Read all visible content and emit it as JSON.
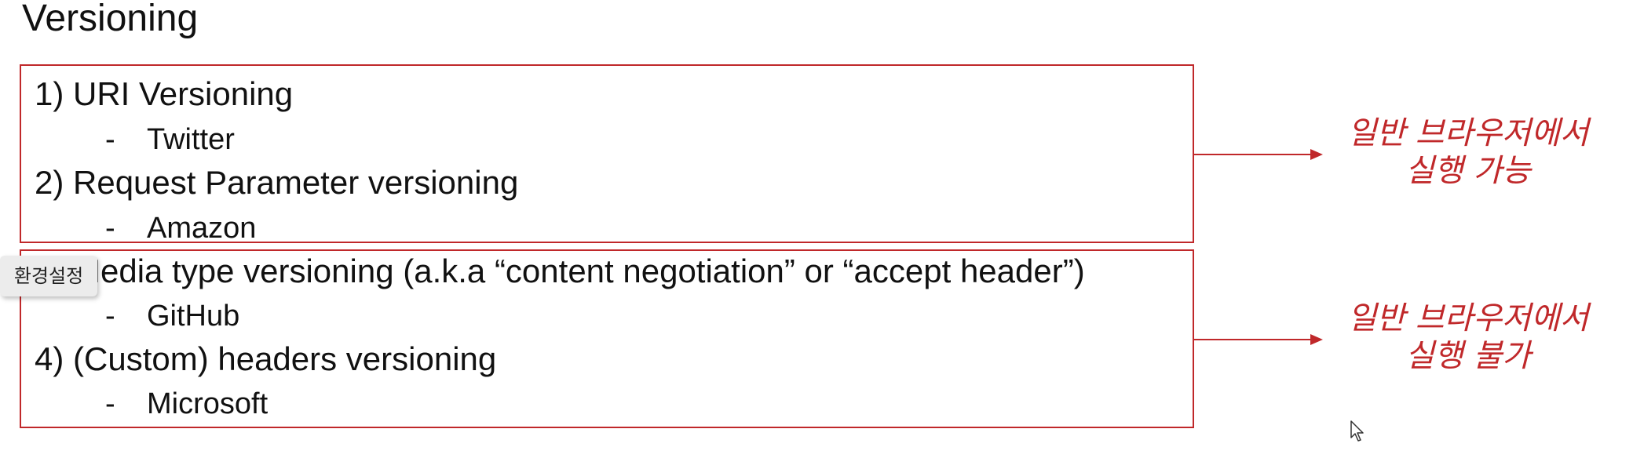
{
  "slide": {
    "title": "Versioning",
    "group1": {
      "items": [
        {
          "label": "1) URI Versioning",
          "example": "Twitter"
        },
        {
          "label": "2) Request Parameter versioning",
          "example": "Amazon"
        }
      ],
      "note_line1": "일반 브라우저에서",
      "note_line2": "실행 가능"
    },
    "group2": {
      "items": [
        {
          "label": "3) Media type versioning (a.k.a “content negotiation” or “accept header”)",
          "example": "GitHub"
        },
        {
          "label": "4) (Custom) headers versioning",
          "example": "Microsoft"
        }
      ],
      "note_line1": "일반 브라우저에서",
      "note_line2": "실행 불가"
    },
    "dash": "-"
  },
  "tooltip": {
    "label": "환경설정"
  },
  "colors": {
    "accent": "#c0282a",
    "text": "#111111"
  },
  "icons": {
    "cursor": "mouse-pointer-icon",
    "arrow": "arrow-right-icon"
  }
}
